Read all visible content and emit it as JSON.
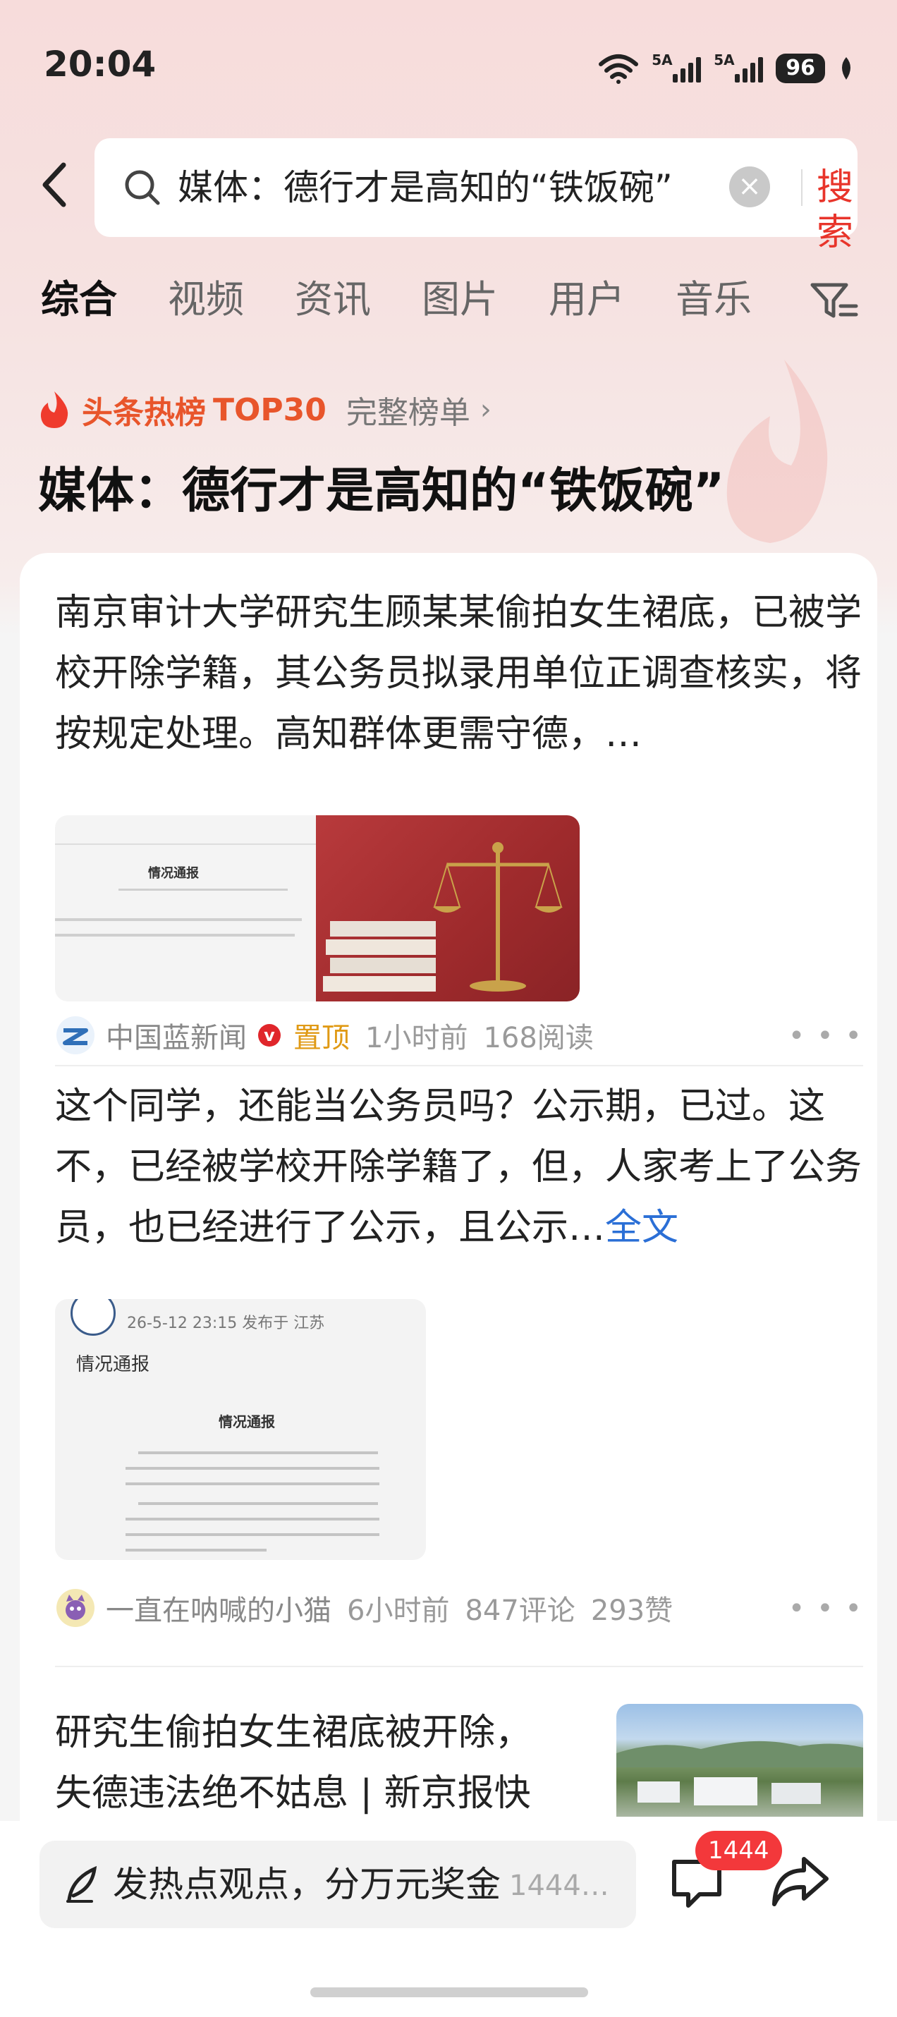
{
  "status_bar": {
    "time": "20:04",
    "signal1": "5A",
    "signal2": "5A",
    "battery": "96"
  },
  "search": {
    "query": "媒体：德行才是高知的“铁饭碗”",
    "button": "搜索"
  },
  "tabs": [
    {
      "label": "综合",
      "active": true
    },
    {
      "label": "视频",
      "active": false
    },
    {
      "label": "资讯",
      "active": false
    },
    {
      "label": "图片",
      "active": false
    },
    {
      "label": "用户",
      "active": false
    },
    {
      "label": "音乐",
      "active": false
    }
  ],
  "hotlist": {
    "label": "头条热榜",
    "top": "TOP30",
    "full_list": "完整榜单",
    "topic": "媒体：德行才是高知的“铁饭碗”"
  },
  "posts": [
    {
      "text": "南京审计大学研究生顾某某偷拍女生裙底，已被学校开除学籍，其公务员拟录用单位正调查核实，将按规定处理。高知群体更需守德，…",
      "image_doc_title": "情况通报",
      "source": "中国蓝新闻",
      "pinned": "置顶",
      "time": "1小时前",
      "reads": "168阅读"
    },
    {
      "text": "这个同学，还能当公务员吗？公示期，已过。这不，已经被学校开除学籍了，但，人家考上了公务员，也已经进行了公示，且公示…",
      "more_link": "全文",
      "image_header": "26-5-12 23:15  发布于 江苏",
      "image_sub": "情况通报",
      "image_doc_title": "情况通报",
      "source": "一直在呐喊的小猫",
      "time": "6小时前",
      "comments": "847评论",
      "likes": "293赞"
    },
    {
      "text": "研究生偷拍女生裙底被开除，失德违法绝不姑息 | 新京报快"
    }
  ],
  "bottom": {
    "comment_prompt": "发热点观点，分万元奖金",
    "comment_count_text": "1444…",
    "badge": "1444"
  },
  "colors": {
    "accent": "#e8352b",
    "link": "#2b6fd6",
    "pinned": "#e09a15"
  }
}
